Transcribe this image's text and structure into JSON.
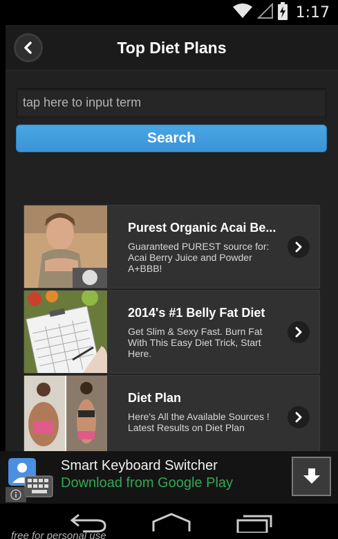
{
  "status_bar": {
    "time": "1:17",
    "icons": [
      "wifi-icon",
      "signal-icon",
      "battery-charging-icon"
    ]
  },
  "header": {
    "title": "Top Diet Plans",
    "back_icon": "chevron-left-icon"
  },
  "search": {
    "placeholder": "tap here to input term",
    "button_label": "Search"
  },
  "results": [
    {
      "title": "Purest Organic Acai Be...",
      "description": "Guaranteed PUREST source for: Acai Berry Juice and Powder A+BBB!",
      "thumbnail": "woman-on-scale-photo"
    },
    {
      "title": "2014's #1 Belly Fat Diet",
      "description": "Get Slim & Sexy Fast. Burn Fat With This Easy Diet Trick, Start Here.",
      "thumbnail": "diet-plan-clipboard-photo"
    },
    {
      "title": "Diet Plan",
      "description": "Here's All the Available Sources ! Latest Results on Diet Plan",
      "thumbnail": "before-after-photo"
    }
  ],
  "ad": {
    "title": "Smart Keyboard Switcher",
    "subtitle": "Download from Google Play",
    "icon": "keyboard-app-icon",
    "info_icon": "info-icon",
    "download_icon": "download-arrow-icon"
  },
  "nav": {
    "buttons": [
      "back-nav-icon",
      "home-nav-icon",
      "recents-nav-icon"
    ],
    "watermark": "free for personal use"
  },
  "colors": {
    "accent": "#3d9bdd",
    "background": "#212121",
    "ad_link": "#34a853"
  }
}
